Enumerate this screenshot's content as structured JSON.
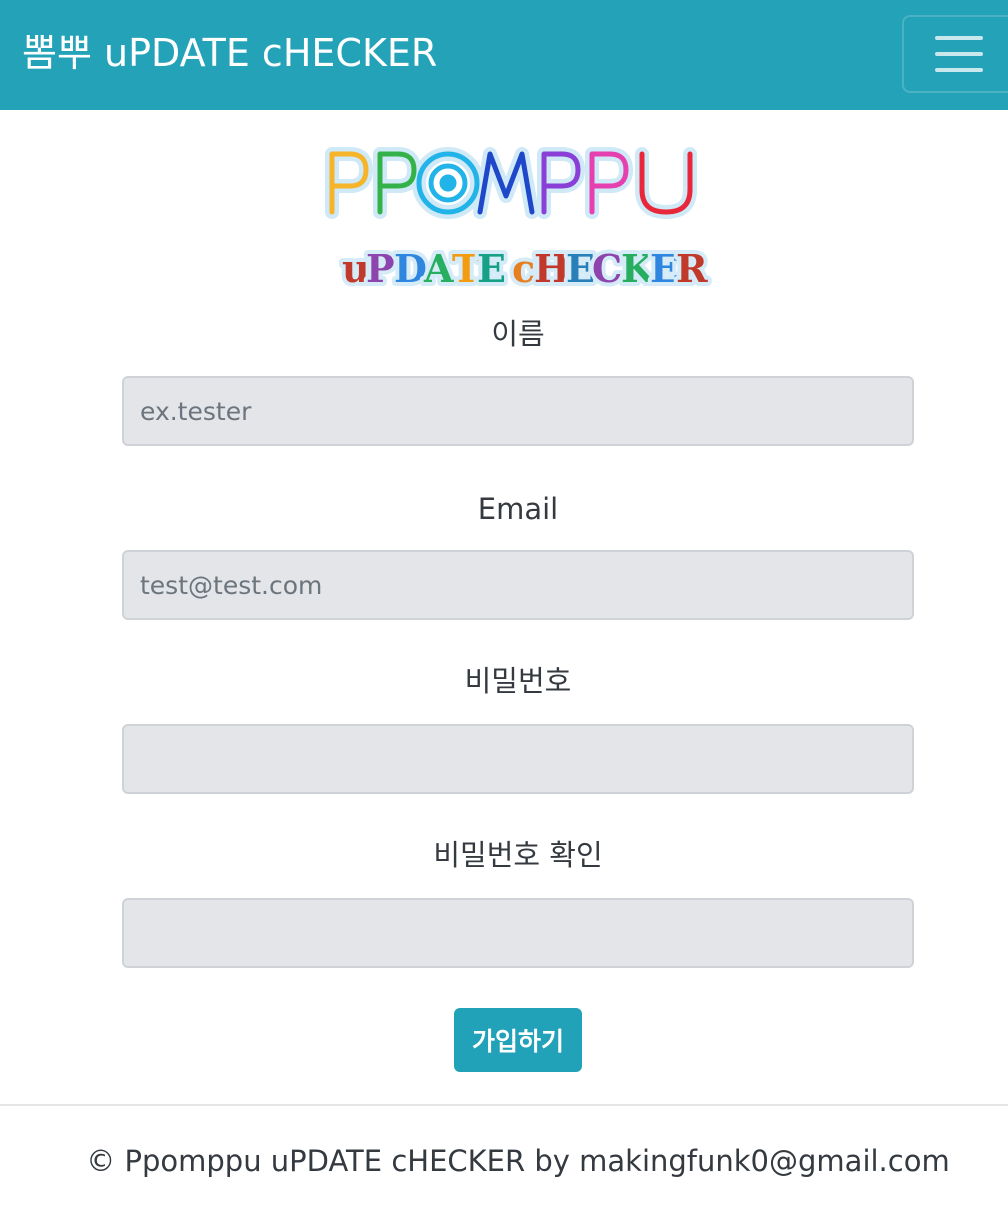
{
  "navbar": {
    "brand": "뽐뿌 uPDATE cHECKER",
    "menu_icon": "hamburger-menu-icon",
    "background_color": "#24a2b8"
  },
  "logo": {
    "line1": "PPOMPPU",
    "line2": "uPDATE cHECKER"
  },
  "form": {
    "name_label": "이름",
    "name_placeholder": "ex.tester",
    "email_label": "Email",
    "email_placeholder": "test@test.com",
    "password_label": "비밀번호",
    "password_confirm_label": "비밀번호 확인",
    "submit_label": "가입하기",
    "submit_color": "#22a2b8"
  },
  "footer": {
    "text": "© Ppomppu uPDATE cHECKER by makingfunk0@gmail.com"
  }
}
